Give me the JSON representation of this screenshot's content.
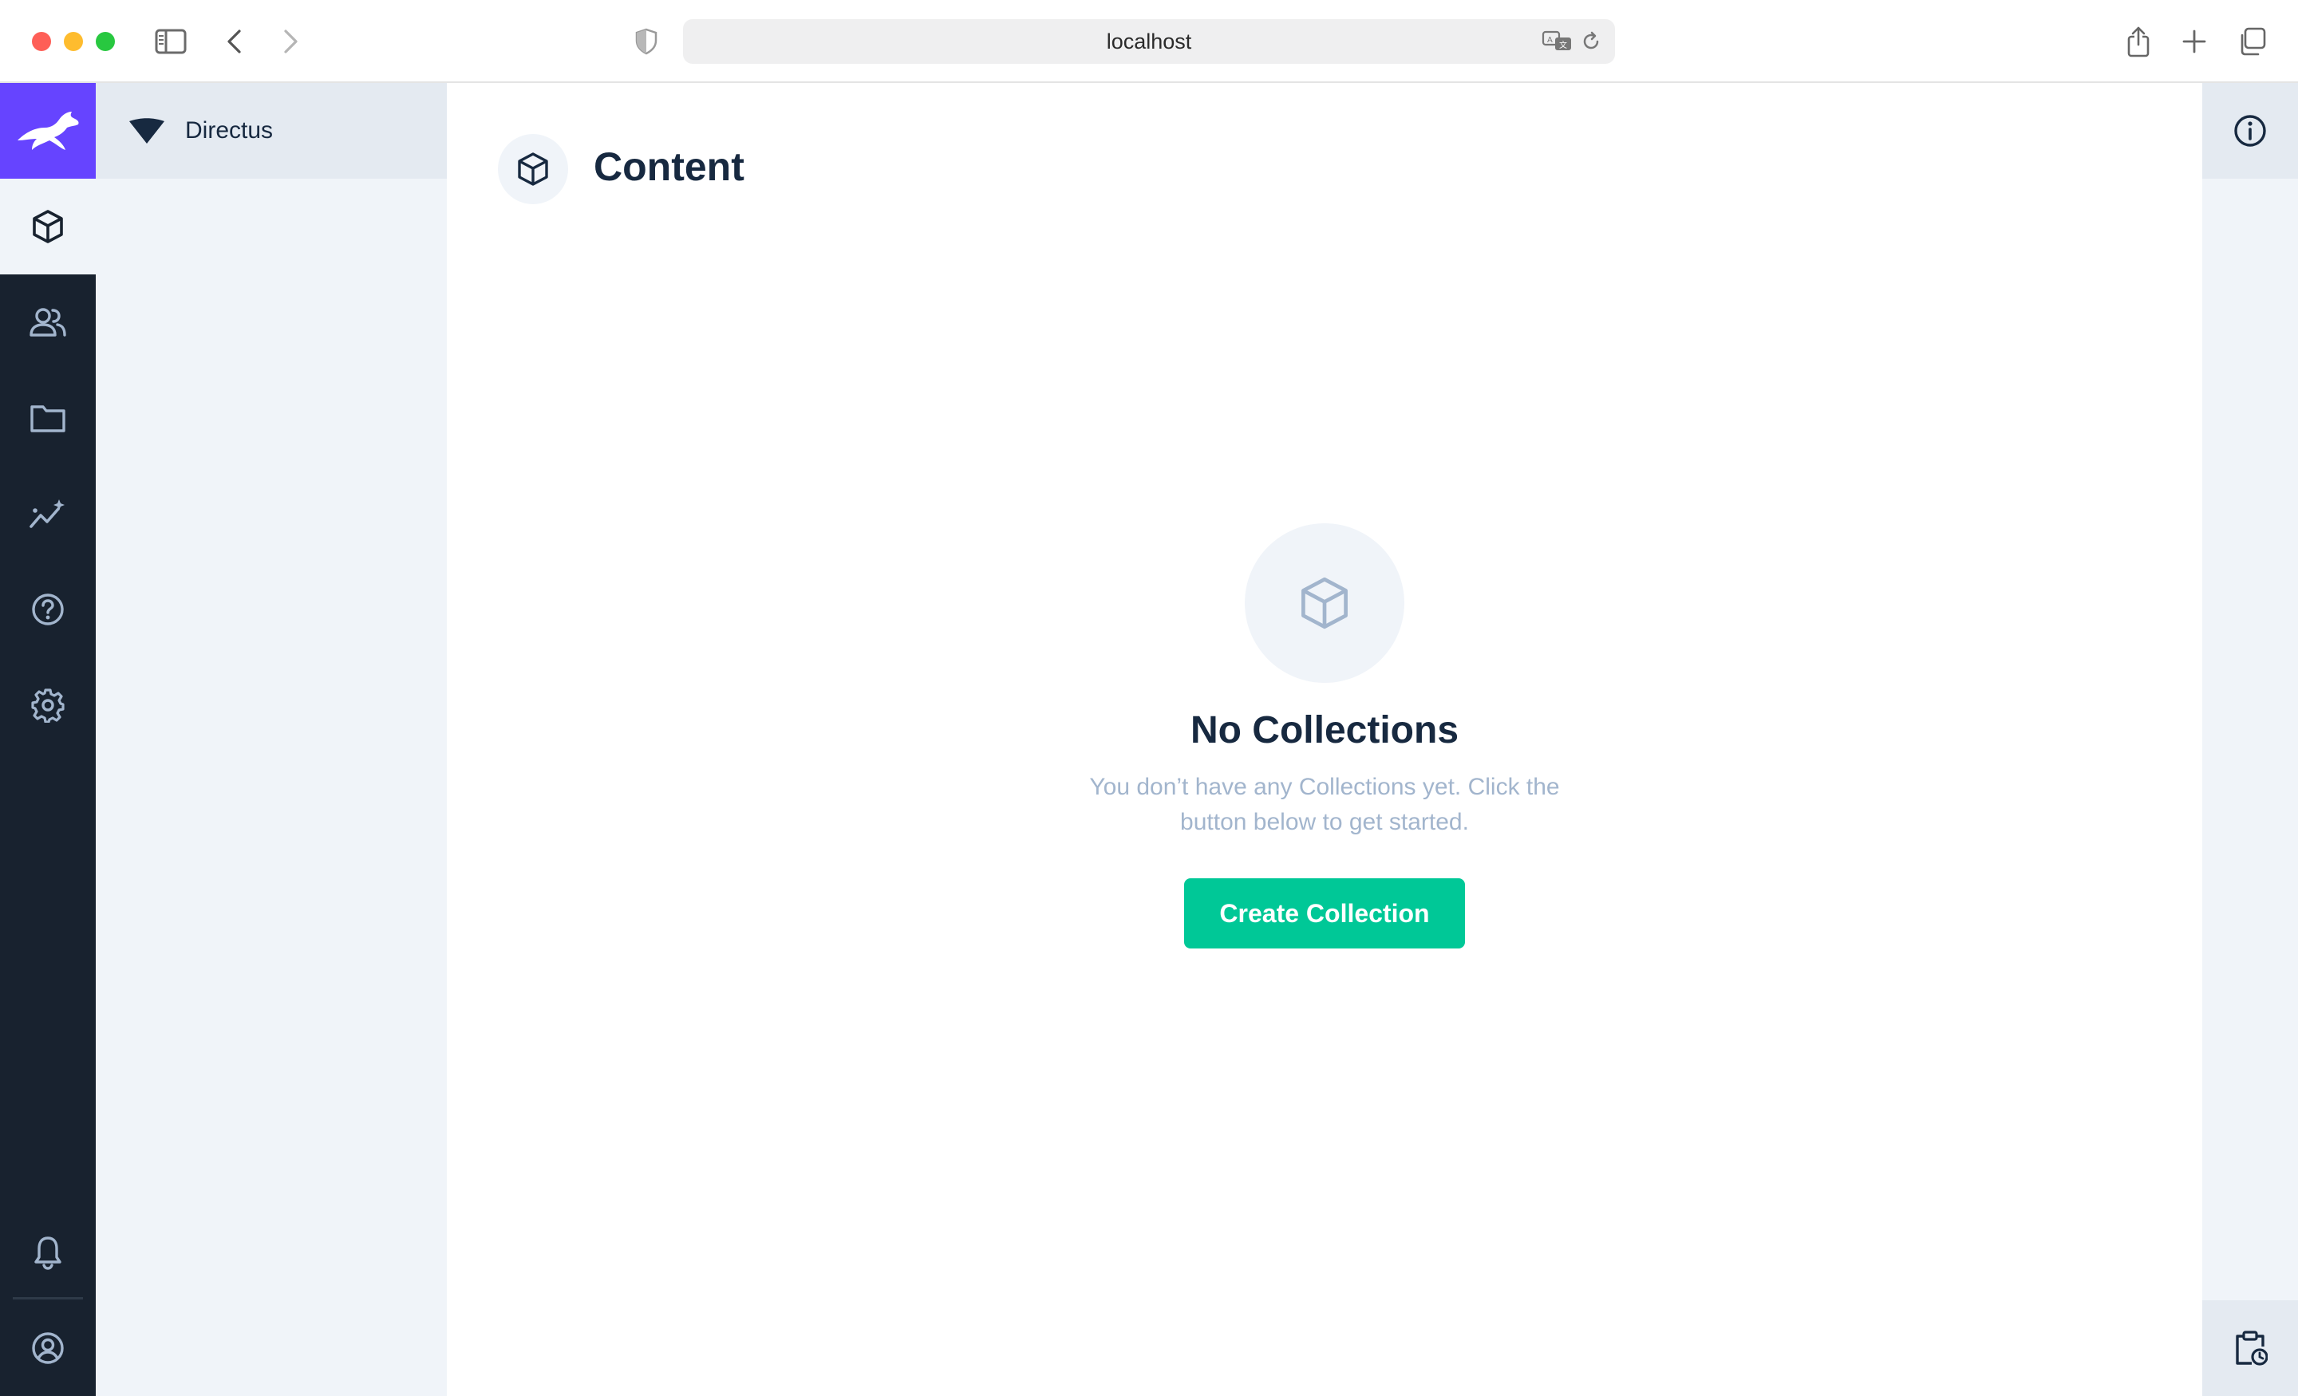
{
  "browser": {
    "address": "localhost"
  },
  "project": {
    "name": "Directus"
  },
  "modules": [
    {
      "name": "content",
      "icon": "box-icon",
      "active": true
    },
    {
      "name": "user-directory",
      "icon": "people-icon",
      "active": false
    },
    {
      "name": "file-library",
      "icon": "folder-icon",
      "active": false
    },
    {
      "name": "insights",
      "icon": "insights-icon",
      "active": false
    },
    {
      "name": "documentation",
      "icon": "help-icon",
      "active": false
    },
    {
      "name": "settings",
      "icon": "gear-icon",
      "active": false
    }
  ],
  "header": {
    "title": "Content"
  },
  "empty_state": {
    "title": "No Collections",
    "description": "You don’t have any Collections yet. Click the button below to get started.",
    "button_label": "Create Collection"
  },
  "colors": {
    "brand": "#6644ff",
    "primary_button": "#00c897",
    "module_bar": "#18222f",
    "nav_background": "#f0f4f9"
  }
}
